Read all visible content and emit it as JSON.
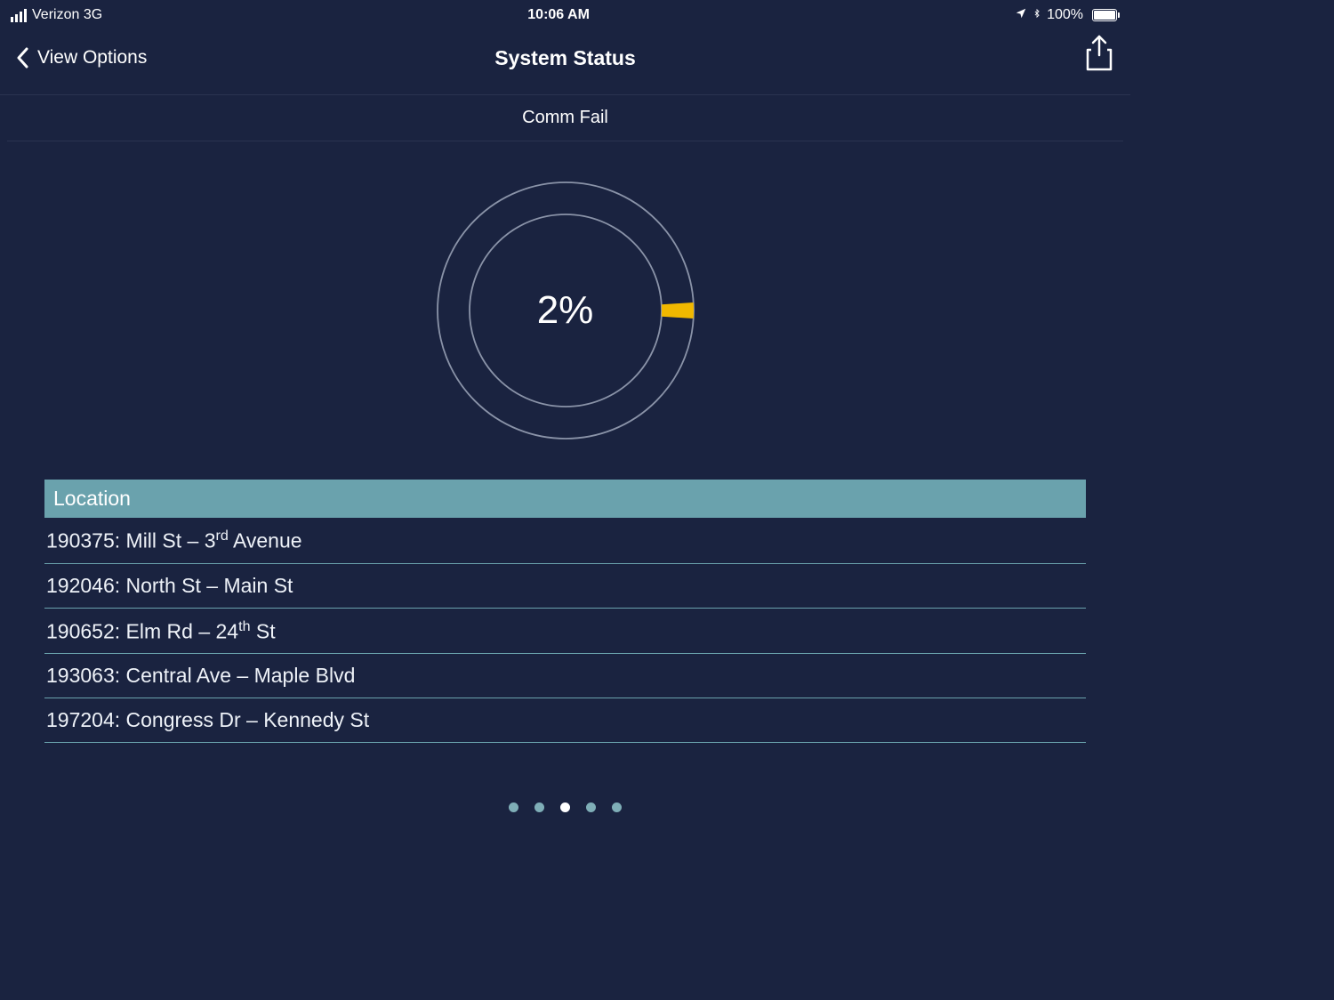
{
  "status_bar": {
    "carrier": "Verizon 3G",
    "time": "10:06 AM",
    "battery_pct": "100%"
  },
  "nav": {
    "back_label": "View Options",
    "title": "System Status"
  },
  "subtitle": "Comm Fail",
  "chart_data": {
    "type": "pie",
    "title": "Comm Fail",
    "value_pct": 2,
    "display": "2%",
    "segment_color": "#f0b800",
    "ring_color": "#9aa3b8"
  },
  "table": {
    "header": "Location",
    "rows": [
      {
        "id": "190375",
        "name": "Mill St – 3rd Avenue",
        "sup": "rd",
        "pre": "190375: Mill St – 3",
        "post": " Avenue"
      },
      {
        "id": "192046",
        "name": "North St – Main St",
        "sup": "",
        "pre": "192046: North St – Main St",
        "post": ""
      },
      {
        "id": "190652",
        "name": "Elm Rd – 24th St",
        "sup": "th",
        "pre": "190652: Elm Rd – 24",
        "post": " St"
      },
      {
        "id": "193063",
        "name": "Central Ave – Maple Blvd",
        "sup": "",
        "pre": "193063: Central Ave – Maple Blvd",
        "post": ""
      },
      {
        "id": "197204",
        "name": "Congress Dr – Kennedy St",
        "sup": "",
        "pre": "197204: Congress Dr – Kennedy St",
        "post": ""
      }
    ]
  },
  "pager": {
    "count": 5,
    "active_index": 2
  }
}
